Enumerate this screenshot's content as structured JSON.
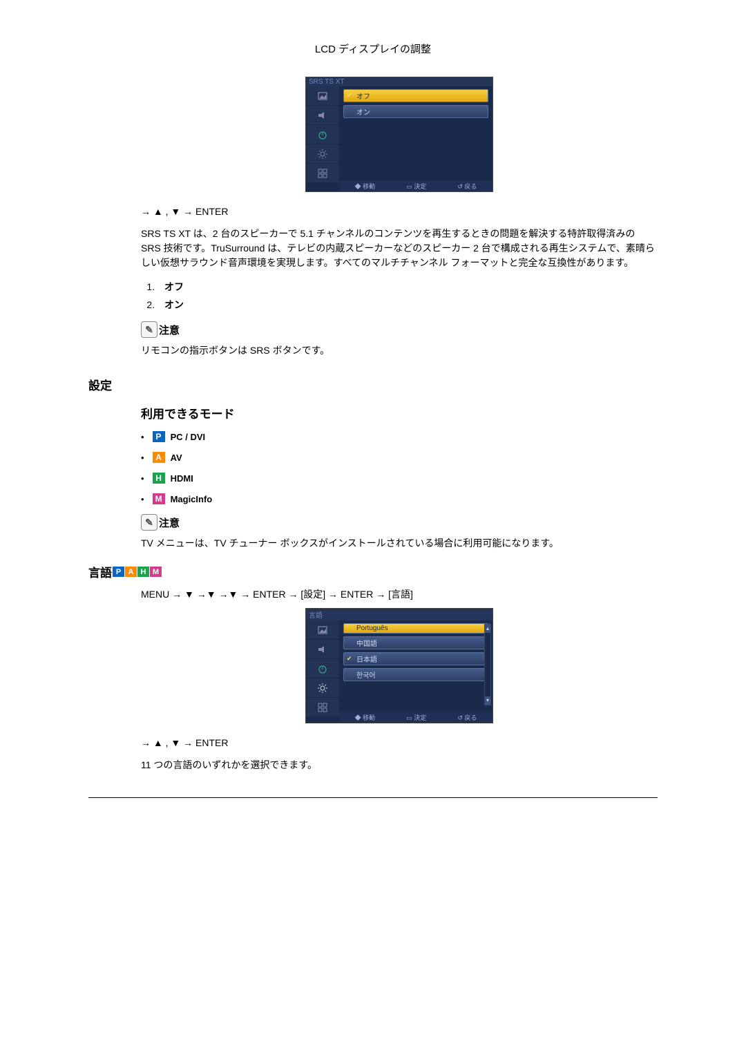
{
  "header": {
    "title": "LCD ディスプレイの調整"
  },
  "osd1": {
    "title": "SRS TS XT",
    "items": [
      {
        "label": "オフ",
        "selected": true,
        "checked": true
      },
      {
        "label": "オン",
        "selected": false,
        "checked": false
      }
    ],
    "footer": {
      "move": "移動",
      "enter": "決定",
      "back": "戻る"
    }
  },
  "nav1": "→ ▲ , ▼ → ENTER",
  "srs_para": "SRS TS XT は、2 台のスピーカーで 5.1 チャンネルのコンテンツを再生するときの問題を解決する特許取得済みの SRS 技術です。TruSurround は、テレビの内蔵スピーカーなどのスピーカー 2 台で構成される再生システムで、素晴らしい仮想サラウンド音声環境を実現します。すべてのマルチチャンネル フォーマットと完全な互換性があります。",
  "srs_options": [
    "オフ",
    "オン"
  ],
  "note1": {
    "title": "注意",
    "body": "リモコンの指示ボタンは SRS ボタンです。"
  },
  "settings_heading": "設定",
  "modes_heading": "利用できるモード",
  "modes": [
    {
      "badge": "P",
      "cls": "p",
      "label": "PC / DVI"
    },
    {
      "badge": "A",
      "cls": "a",
      "label": "AV"
    },
    {
      "badge": "H",
      "cls": "h",
      "label": "HDMI"
    },
    {
      "badge": "M",
      "cls": "m",
      "label": "MagicInfo"
    }
  ],
  "note2": {
    "title": "注意",
    "body": "TV メニューは、TV チューナー ボックスがインストールされている場合に利用可能になります。"
  },
  "language_heading": "言語",
  "path_line": "MENU → ▼ →▼ →▼ → ENTER → [設定] → ENTER → [言語]",
  "osd2": {
    "title": "言語",
    "items": [
      {
        "label": "Português",
        "selected": true,
        "checked": false
      },
      {
        "label": "中国語",
        "selected": false,
        "checked": false
      },
      {
        "label": "日本語",
        "selected": false,
        "checked": true
      },
      {
        "label": "한국어",
        "selected": false,
        "checked": false
      }
    ],
    "footer": {
      "move": "移動",
      "enter": "決定",
      "back": "戻る"
    }
  },
  "nav2": "→ ▲ , ▼ → ENTER",
  "lang_para": "11 つの言語のいずれかを選択できます。"
}
